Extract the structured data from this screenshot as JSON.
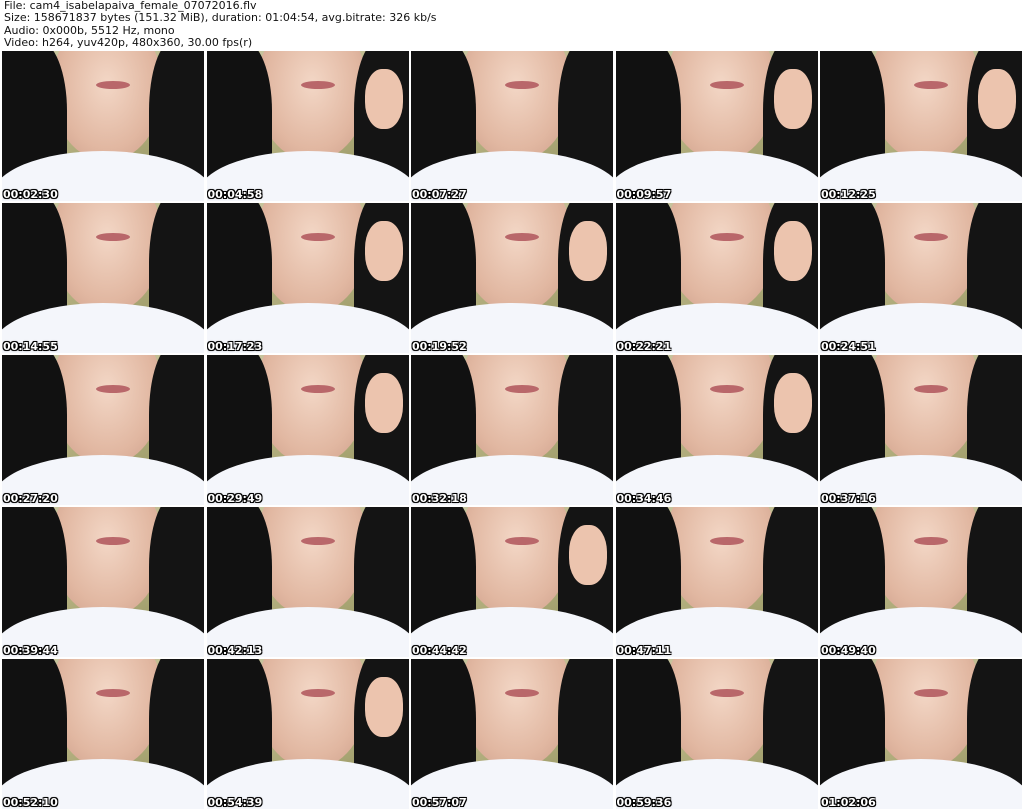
{
  "header": {
    "file_line": "File: cam4_isabelapaiva_female_07072016.flv",
    "size_line": "Size: 158671837 bytes (151.32 MiB), duration: 01:04:54, avg.bitrate: 326 kb/s",
    "audio_line": "Audio: 0x000b, 5512 Hz, mono",
    "video_line": "Video: h264, yuv420p, 480x360, 30.00 fps(r)"
  },
  "thumbnails": [
    {
      "timestamp": "00:02:30",
      "hand": false
    },
    {
      "timestamp": "00:04:58",
      "hand": true
    },
    {
      "timestamp": "00:07:27",
      "hand": false
    },
    {
      "timestamp": "00:09:57",
      "hand": true
    },
    {
      "timestamp": "00:12:25",
      "hand": true
    },
    {
      "timestamp": "00:14:55",
      "hand": false
    },
    {
      "timestamp": "00:17:23",
      "hand": true
    },
    {
      "timestamp": "00:19:52",
      "hand": true
    },
    {
      "timestamp": "00:22:21",
      "hand": true
    },
    {
      "timestamp": "00:24:51",
      "hand": false
    },
    {
      "timestamp": "00:27:20",
      "hand": false
    },
    {
      "timestamp": "00:29:49",
      "hand": true
    },
    {
      "timestamp": "00:32:18",
      "hand": false
    },
    {
      "timestamp": "00:34:46",
      "hand": true
    },
    {
      "timestamp": "00:37:16",
      "hand": false
    },
    {
      "timestamp": "00:39:44",
      "hand": false
    },
    {
      "timestamp": "00:42:13",
      "hand": false
    },
    {
      "timestamp": "00:44:42",
      "hand": true
    },
    {
      "timestamp": "00:47:11",
      "hand": false
    },
    {
      "timestamp": "00:49:40",
      "hand": false
    },
    {
      "timestamp": "00:52:10",
      "hand": false
    },
    {
      "timestamp": "00:54:39",
      "hand": true
    },
    {
      "timestamp": "00:57:07",
      "hand": false
    },
    {
      "timestamp": "00:59:36",
      "hand": false
    },
    {
      "timestamp": "01:02:06",
      "hand": false
    }
  ]
}
